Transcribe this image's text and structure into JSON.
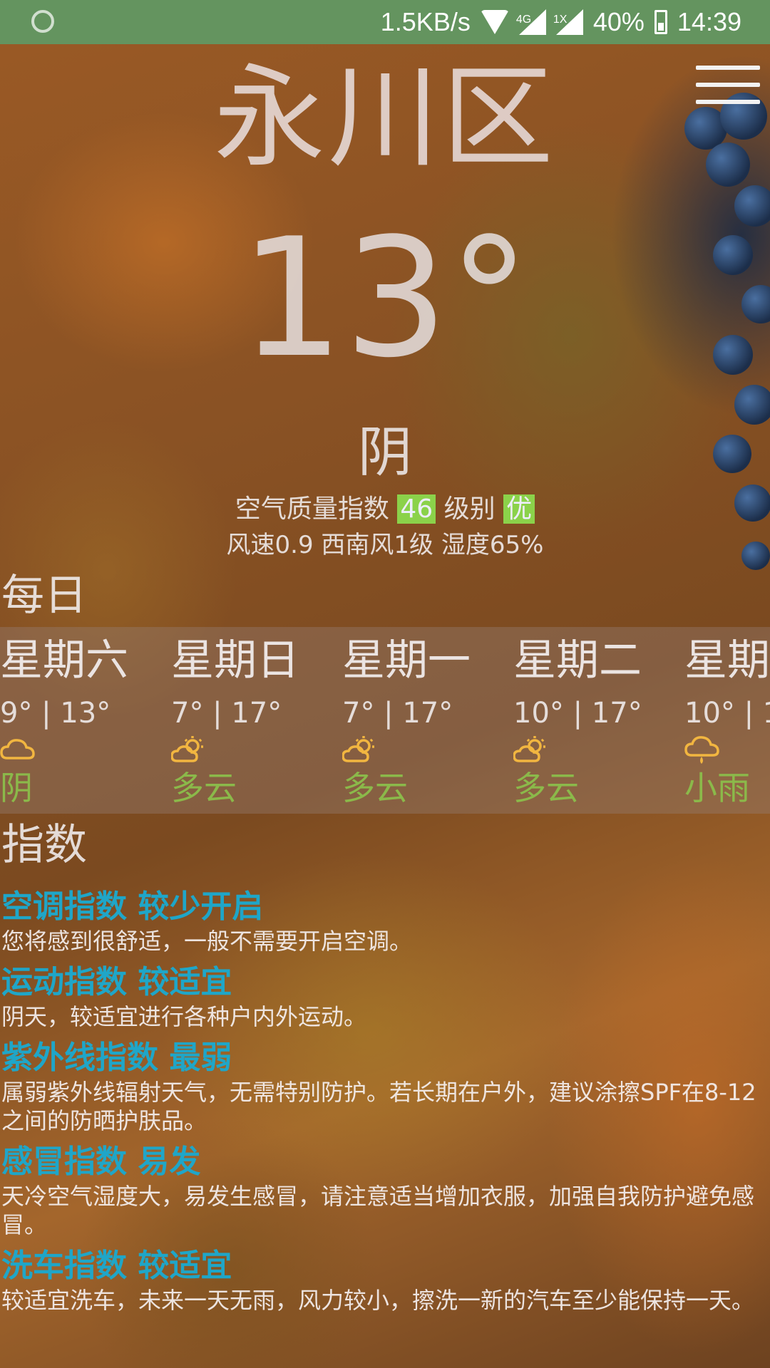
{
  "status_bar": {
    "net_speed": "1.5KB/s",
    "sim1_label": "4G",
    "sim2_label": "1X",
    "battery": "40%",
    "time": "14:39"
  },
  "header": {
    "city": "永川区",
    "temperature": "13°",
    "condition": "阴",
    "aqi_label": "空气质量指数",
    "aqi_value": "46",
    "level_label": "级别",
    "level_value": "优",
    "wind_humidity": "风速0.9 西南风1级 湿度65%"
  },
  "daily": {
    "title": "每日",
    "days": [
      {
        "weekday": "星期六",
        "range": "9° | 13°",
        "icon": "cloud-icon",
        "desc": "阴"
      },
      {
        "weekday": "星期日",
        "range": "7° | 17°",
        "icon": "partly-cloudy-icon",
        "desc": "多云"
      },
      {
        "weekday": "星期一",
        "range": "7° | 17°",
        "icon": "partly-cloudy-icon",
        "desc": "多云"
      },
      {
        "weekday": "星期二",
        "range": "10° | 17°",
        "icon": "partly-cloudy-icon",
        "desc": "多云"
      },
      {
        "weekday": "星期",
        "range": "10° | 1",
        "icon": "light-rain-icon",
        "desc": "小雨"
      }
    ]
  },
  "indices": {
    "title": "指数",
    "items": [
      {
        "title": "空调指数 较少开启",
        "desc": "您将感到很舒适，一般不需要开启空调。"
      },
      {
        "title": "运动指数 较适宜",
        "desc": "阴天，较适宜进行各种户内外运动。"
      },
      {
        "title": "紫外线指数 最弱",
        "desc": "属弱紫外线辐射天气，无需特别防护。若长期在户外，建议涂擦SPF在8-12之间的防晒护肤品。"
      },
      {
        "title": "感冒指数 易发",
        "desc": "天冷空气湿度大，易发生感冒，请注意适当增加衣服，加强自我防护避免感冒。"
      },
      {
        "title": "洗车指数 较适宜",
        "desc": "较适宜洗车，未来一天无雨，风力较小，擦洗一新的汽车至少能保持一天。"
      }
    ]
  },
  "colors": {
    "status_bar": "#64945f",
    "index_title": "#1fa6c8",
    "forecast_desc": "#8bb94a",
    "aqi_highlight": "#8bd24a",
    "icon": "#f2b640"
  }
}
